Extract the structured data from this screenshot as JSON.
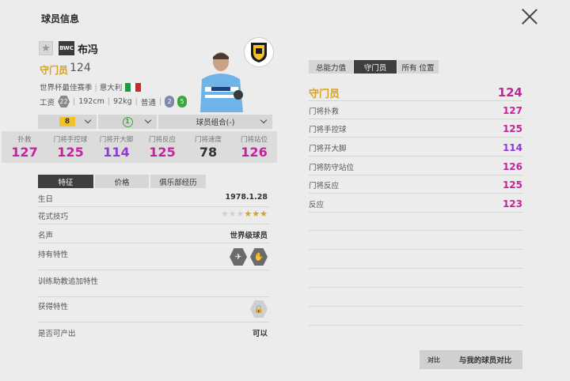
{
  "header": {
    "title": "球员信息"
  },
  "player": {
    "badge": "BWC",
    "name": "布冯",
    "position": "守门员",
    "overall": "124",
    "season": "世界杯最佳赛季",
    "nationality": "意大利",
    "wage": "22",
    "height": "192cm",
    "weight": "92kg",
    "body_type": "普通",
    "weak_foot": "2",
    "skill_level": "5"
  },
  "selectors": {
    "enhance_level": "8",
    "grade": "1",
    "team_color": "球员组合(-)"
  },
  "stats": [
    {
      "label": "扑救",
      "value": "127",
      "color": "#c2259b"
    },
    {
      "label": "门将手控球",
      "value": "125",
      "color": "#c2259b"
    },
    {
      "label": "门将开大脚",
      "value": "114",
      "color": "#8e3ad6"
    },
    {
      "label": "门将反应",
      "value": "125",
      "color": "#c2259b"
    },
    {
      "label": "门将速度",
      "value": "78",
      "color": "#333333"
    },
    {
      "label": "门将站位",
      "value": "126",
      "color": "#c2259b"
    }
  ],
  "left_tabs": [
    "特征",
    "价格",
    "俱乐部经历"
  ],
  "info": {
    "birthday_label": "生日",
    "birthday": "1978.1.28",
    "skill_label": "花式技巧",
    "skill_stars": "★★★",
    "fame_label": "名声",
    "fame": "世界级球员",
    "traits_label": "持有特性",
    "coach_label": "训练助教追加特性",
    "acquired_label": "获得特性",
    "producible_label": "是否可产出",
    "producible": "可以"
  },
  "right_tabs": [
    "总能力值",
    "守门员",
    "所有 位置"
  ],
  "position_rating": {
    "label": "守门员",
    "value": "124"
  },
  "attributes": [
    {
      "label": "门将扑救",
      "value": "127",
      "color": "#c2259b"
    },
    {
      "label": "门将手控球",
      "value": "125",
      "color": "#c2259b"
    },
    {
      "label": "门将开大脚",
      "value": "114",
      "color": "#8e3ad6"
    },
    {
      "label": "门将防守站位",
      "value": "126",
      "color": "#c2259b"
    },
    {
      "label": "门将反应",
      "value": "125",
      "color": "#c2259b"
    },
    {
      "label": "反应",
      "value": "123",
      "color": "#c2259b"
    }
  ],
  "compare": {
    "icon_text": "对比",
    "label": "与我的球员对比"
  }
}
